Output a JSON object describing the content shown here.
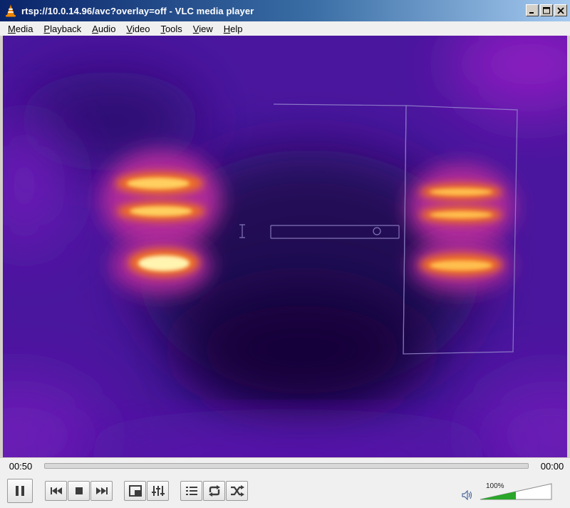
{
  "window": {
    "title": "rtsp://10.0.14.96/avc?overlay=off - VLC media player",
    "minimize_label": "Minimize",
    "maximize_label": "Maximize",
    "close_label": "Close"
  },
  "menu": {
    "items": [
      {
        "label": "Media",
        "accel": "M",
        "rest": "edia"
      },
      {
        "label": "Playback",
        "accel": "P",
        "rest": "layback"
      },
      {
        "label": "Audio",
        "accel": "A",
        "rest": "udio"
      },
      {
        "label": "Video",
        "accel": "V",
        "rest": "ideo"
      },
      {
        "label": "Tools",
        "accel": "T",
        "rest": "ools"
      },
      {
        "label": "View",
        "accel": "V",
        "rest": "iew"
      },
      {
        "label": "Help",
        "accel": "H",
        "rest": "elp"
      }
    ]
  },
  "seek": {
    "elapsed": "00:50",
    "remaining": "00:00",
    "progress": 0
  },
  "controls": {
    "pause": "pause-icon",
    "previous": "previous-icon",
    "stop": "stop-icon",
    "next": "next-icon",
    "fullscreen": "fullscreen-icon",
    "extended": "equalizer-icon",
    "playlist": "playlist-icon",
    "loop": "loop-icon",
    "random": "shuffle-icon"
  },
  "volume": {
    "label": "100%",
    "level": 1.0
  },
  "colors": {
    "accent": "#2aa62a",
    "title_bar": "#0a246a",
    "video_bg": "#46149b"
  }
}
